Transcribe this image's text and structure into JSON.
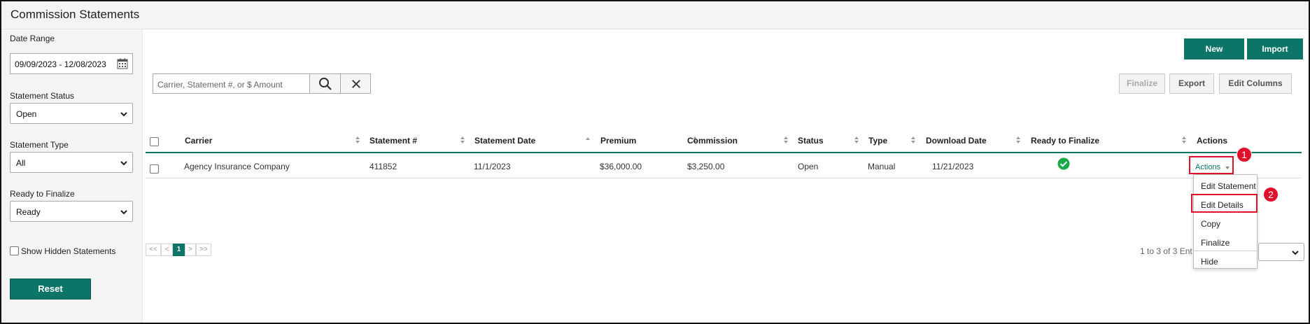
{
  "app": {
    "title": "Commission Statements"
  },
  "sidebar": {
    "date_range_label": "Date Range",
    "date_range_value": "09/09/2023 - 12/08/2023",
    "status_label": "Statement Status",
    "status_value": "Open",
    "type_label": "Statement Type",
    "type_value": "All",
    "ready_label": "Ready to Finalize",
    "ready_value": "Ready",
    "show_hidden_label": "Show Hidden Statements",
    "show_hidden_checked": false,
    "reset_label": "Reset"
  },
  "toolbar": {
    "new_label": "New",
    "import_label": "Import",
    "search_placeholder": "Carrier, Statement #, or $ Amount",
    "finalize_label": "Finalize",
    "export_label": "Export",
    "edit_columns_label": "Edit Columns"
  },
  "table": {
    "columns": [
      "Carrier",
      "Statement #",
      "Statement Date",
      "Premium",
      "Commission",
      "Status",
      "Type",
      "Download Date",
      "Ready to Finalize",
      "Actions"
    ],
    "rows": [
      {
        "carrier": "Agency Insurance Company",
        "statement_no": "411852",
        "statement_date": "11/1/2023",
        "premium": "$36,000.00",
        "commission": "$3,250.00",
        "status": "Open",
        "type": "Manual",
        "download_date": "11/21/2023",
        "ready": true,
        "actions_label": "Actions"
      }
    ]
  },
  "actions_menu": {
    "items": [
      "Edit Statement",
      "Edit Details",
      "Copy",
      "Finalize",
      "Hide"
    ]
  },
  "annotations": {
    "step1": "1",
    "step2": "2"
  },
  "pagination": {
    "first": "<<",
    "prev": "<",
    "current": "1",
    "next": ">",
    "last": ">>",
    "entries_text": "1 to 3 of 3 Ent"
  },
  "colors": {
    "accent": "#0c7568",
    "highlight": "#e0102a",
    "ready_check": "#1aa84b"
  },
  "icons": {
    "calendar": "calendar-icon",
    "search": "search-icon",
    "clear": "close-icon",
    "sort": "sort-icon",
    "ready": "check-circle-icon",
    "dropdown": "chevron-down-icon"
  }
}
